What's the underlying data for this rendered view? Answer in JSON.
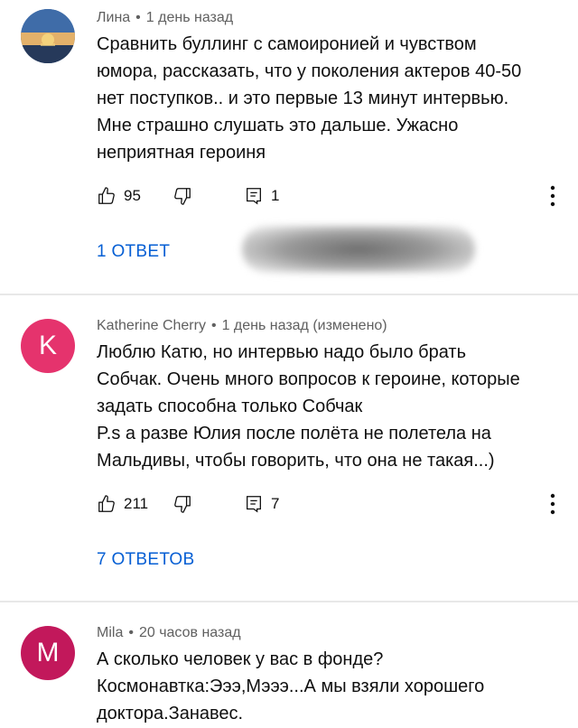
{
  "comments": [
    {
      "author": "Лина",
      "time": "1 день назад",
      "avatar_letter": "",
      "lines": [
        "Сравнить буллинг с самоиронией и чувством",
        "юмора, рассказать, что у поколения актеров 40-50",
        "нет поступков.. и это первые 13 минут интервью.",
        "Мне страшно слушать это дальше. Ужасно",
        "неприятная героиня"
      ],
      "likes": "95",
      "reply_count": "1",
      "replies_label": "1 ОТВЕТ"
    },
    {
      "author": "Katherine Cherry",
      "time": "1 день назад (изменено)",
      "avatar_letter": "K",
      "lines": [
        "Люблю Катю, но интервью надо было брать",
        "Собчак. Очень много вопросов к героине, которые",
        "задать способна только Собчак",
        "P.s а разве Юлия после полёта не полетела на",
        "Мальдивы, чтобы говорить, что она не такая...)"
      ],
      "likes": "211",
      "reply_count": "7",
      "replies_label": "7 ОТВЕТОВ"
    },
    {
      "author": "Mila",
      "time": "20 часов назад",
      "avatar_letter": "M",
      "lines": [
        "А сколько человек у вас в фонде?",
        "Космонавтка:Эээ,Мэээ...А мы взяли хорошего",
        "доктора.Занавес."
      ]
    }
  ],
  "separator": "•",
  "colors": {
    "link_blue": "#065fd4",
    "avatar_k": "#e5336d",
    "avatar_m": "#c2185b",
    "meta_gray": "#606060"
  },
  "icons": [
    "thumb-up-icon",
    "thumb-down-icon",
    "reply-icon",
    "more-vert-icon"
  ]
}
